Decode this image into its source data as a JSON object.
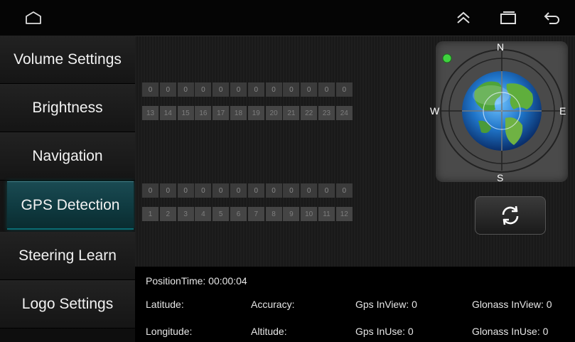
{
  "system_bar": {
    "home_icon": "home-icon",
    "collapse_icon": "double-chevron-up-icon",
    "recents_icon": "recent-apps-icon",
    "back_icon": "back-icon"
  },
  "sidebar": {
    "items": [
      {
        "label": "Volume Settings",
        "active": false
      },
      {
        "label": "Brightness",
        "active": false
      },
      {
        "label": "Navigation",
        "active": false
      },
      {
        "label": "GPS Detection",
        "active": true
      },
      {
        "label": "Steering Learn",
        "active": false
      },
      {
        "label": "Logo Settings",
        "active": false
      }
    ]
  },
  "satellites": {
    "upper": {
      "signals": [
        "0",
        "0",
        "0",
        "0",
        "0",
        "0",
        "0",
        "0",
        "0",
        "0",
        "0",
        "0"
      ],
      "ids": [
        "13",
        "14",
        "15",
        "16",
        "17",
        "18",
        "19",
        "20",
        "21",
        "22",
        "23",
        "24"
      ]
    },
    "lower": {
      "signals": [
        "0",
        "0",
        "0",
        "0",
        "0",
        "0",
        "0",
        "0",
        "0",
        "0",
        "0",
        "0"
      ],
      "ids": [
        "1",
        "2",
        "3",
        "4",
        "5",
        "6",
        "7",
        "8",
        "9",
        "10",
        "11",
        "12"
      ]
    }
  },
  "compass": {
    "north": "N",
    "south": "S",
    "east": "E",
    "west": "W",
    "status_color": "#3fd23f"
  },
  "info": {
    "position_time": "PositionTime: 00:00:04",
    "latitude": "Latitude:",
    "accuracy": "Accuracy:",
    "gps_inview": "Gps InView: 0",
    "glonass_inview": "Glonass InView: 0",
    "longitude": "Longitude:",
    "altitude": "Altitude:",
    "gps_inuse": "Gps InUse: 0",
    "glonass_inuse": "Glonass InUse: 0"
  },
  "colors": {
    "accent": "#0f3a40",
    "active_border": "#0a6b72"
  }
}
